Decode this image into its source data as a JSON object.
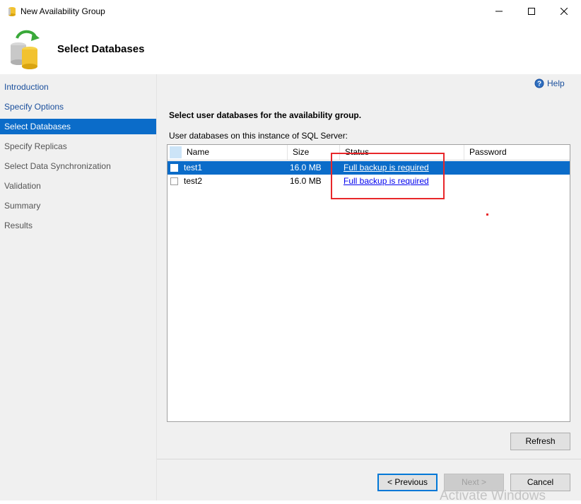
{
  "window": {
    "title": "New Availability Group"
  },
  "header": {
    "title": "Select Databases"
  },
  "sidebar": {
    "items": [
      {
        "label": "Introduction",
        "state": "link"
      },
      {
        "label": "Specify Options",
        "state": "link"
      },
      {
        "label": "Select Databases",
        "state": "selected"
      },
      {
        "label": "Specify Replicas",
        "state": "disabled"
      },
      {
        "label": "Select Data Synchronization",
        "state": "disabled"
      },
      {
        "label": "Validation",
        "state": "disabled"
      },
      {
        "label": "Summary",
        "state": "disabled"
      },
      {
        "label": "Results",
        "state": "disabled"
      }
    ]
  },
  "help": {
    "label": "Help"
  },
  "main": {
    "instruction": "Select user databases for the availability group.",
    "grid_label": "User databases on this instance of SQL Server:",
    "columns": [
      "Name",
      "Size",
      "Status",
      "Password"
    ],
    "rows": [
      {
        "name": "test1",
        "size": "16.0 MB",
        "status": "Full backup is required",
        "password": "",
        "selected": true,
        "checked": false
      },
      {
        "name": "test2",
        "size": "16.0 MB",
        "status": "Full backup is required",
        "password": "",
        "selected": false,
        "checked": false
      }
    ],
    "refresh_label": "Refresh"
  },
  "footer": {
    "previous_label": "< Previous",
    "next_label": "Next >",
    "cancel_label": "Cancel"
  },
  "watermark": "Activate Windows",
  "colors": {
    "selection": "#0b6cc9",
    "highlight": "#e8272a",
    "link": "#1a4f9c"
  }
}
